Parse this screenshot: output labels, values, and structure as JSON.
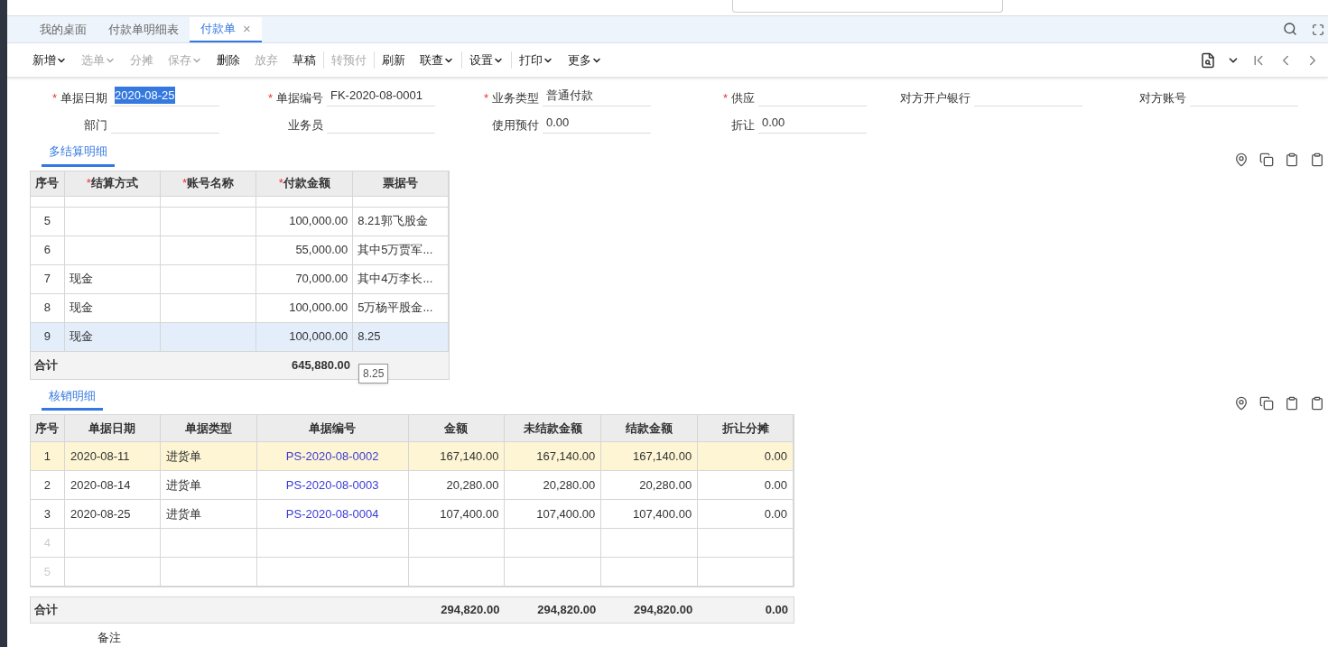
{
  "tabs": [
    {
      "label": "我的桌面",
      "selected": false,
      "closable": false
    },
    {
      "label": "付款单明细表",
      "selected": false,
      "closable": false
    },
    {
      "label": "付款单",
      "selected": true,
      "closable": true
    }
  ],
  "close_glyph": "×",
  "required_mark": "*",
  "toolbar": [
    {
      "label": "新增",
      "disabled": false,
      "menu": true,
      "sep": false
    },
    {
      "label": "选单",
      "disabled": true,
      "menu": true,
      "sep": false
    },
    {
      "label": "分摊",
      "disabled": true,
      "menu": false,
      "sep": false
    },
    {
      "label": "保存",
      "disabled": true,
      "menu": true,
      "sep": false
    },
    {
      "label": "删除",
      "disabled": false,
      "menu": false,
      "sep": false
    },
    {
      "label": "放弃",
      "disabled": true,
      "menu": false,
      "sep": false
    },
    {
      "label": "草稿",
      "disabled": false,
      "menu": false,
      "sep": true
    },
    {
      "label": "转预付",
      "disabled": true,
      "menu": false,
      "sep": true
    },
    {
      "label": "刷新",
      "disabled": false,
      "menu": false,
      "sep": false
    },
    {
      "label": "联查",
      "disabled": false,
      "menu": true,
      "sep": true
    },
    {
      "label": "设置",
      "disabled": false,
      "menu": true,
      "sep": true
    },
    {
      "label": "打印",
      "disabled": false,
      "menu": true,
      "sep": false
    },
    {
      "label": "更多",
      "disabled": false,
      "menu": true,
      "sep": false
    }
  ],
  "form_rows": [
    [
      {
        "label": "单据日期",
        "required": true,
        "value": "2020-08-25",
        "highlighted": true
      },
      {
        "label": "单据编号",
        "required": true,
        "value": "FK-2020-08-0001",
        "highlighted": false
      },
      {
        "label": "业务类型",
        "required": true,
        "value": "普通付款",
        "highlighted": false
      },
      {
        "label": "供应",
        "required": true
      },
      {
        "label": "对方开户银行",
        "required": false
      },
      {
        "label": "对方账号",
        "required": false
      }
    ],
    [
      {
        "label": "部门",
        "required": false
      },
      {
        "label": "业务员",
        "required": false
      },
      {
        "label": "使用预付",
        "required": false,
        "value": "0.00",
        "highlighted": false
      },
      {
        "label": "折让",
        "required": false,
        "value": "0.00",
        "highlighted": false
      }
    ]
  ],
  "settlement": {
    "title": "多结算明细",
    "columns": [
      {
        "label": "序号",
        "required": false
      },
      {
        "label": "结算方式",
        "required": true
      },
      {
        "label": "账号名称",
        "required": true
      },
      {
        "label": "付款金额",
        "required": true
      },
      {
        "label": "票据号",
        "required": false
      }
    ],
    "rows": [
      {
        "no": "5",
        "amount": "100,000.00",
        "ticket": "8.21郭飞股金",
        "selected": false
      },
      {
        "no": "6",
        "amount": "55,000.00",
        "ticket": "其中5万贾军...",
        "selected": false
      },
      {
        "no": "7",
        "method": "现金",
        "amount": "70,000.00",
        "ticket": "其中4万李长...",
        "selected": false
      },
      {
        "no": "8",
        "method": "现金",
        "amount": "100,000.00",
        "ticket": "5万杨平股金...",
        "selected": false
      },
      {
        "no": "9",
        "method": "现金",
        "amount": "100,000.00",
        "ticket": "8.25",
        "selected": true
      }
    ],
    "total_label": "合计",
    "total": "645,880.00",
    "tooltip": "8.25"
  },
  "writeoff": {
    "title": "核销明细",
    "columns": [
      "序号",
      "单据日期",
      "单据类型",
      "单据编号",
      "金额",
      "未结款金额",
      "结款金额",
      "折让分摊"
    ],
    "rows": [
      {
        "no": "1",
        "date": "2020-08-11",
        "type": "进货单",
        "code": "PS-2020-08-0002",
        "amount": "167,140.00",
        "unpaid": "167,140.00",
        "paid": "167,140.00",
        "discount": "0.00",
        "selected": true,
        "empty": false
      },
      {
        "no": "2",
        "date": "2020-08-14",
        "type": "进货单",
        "code": "PS-2020-08-0003",
        "amount": "20,280.00",
        "unpaid": "20,280.00",
        "paid": "20,280.00",
        "discount": "0.00",
        "selected": false,
        "empty": false
      },
      {
        "no": "3",
        "date": "2020-08-25",
        "type": "进货单",
        "code": "PS-2020-08-0004",
        "amount": "107,400.00",
        "unpaid": "107,400.00",
        "paid": "107,400.00",
        "discount": "0.00",
        "selected": false,
        "empty": false
      },
      {
        "no": "4",
        "selected": false,
        "empty": true
      },
      {
        "no": "5",
        "selected": false,
        "empty": true
      }
    ],
    "total_label": "合计",
    "totals": [
      "294,820.00",
      "294,820.00",
      "294,820.00",
      "0.00"
    ]
  },
  "remark_label": "备注"
}
